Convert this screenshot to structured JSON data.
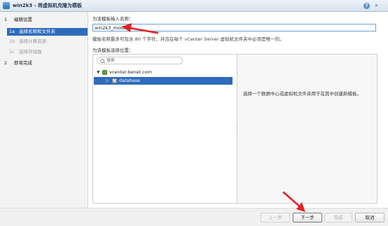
{
  "window": {
    "title": "win2k3 - 将虚拟机克隆为模板"
  },
  "sidebar": {
    "steps": [
      {
        "num": "1",
        "label": "编辑设置"
      },
      {
        "num": "1a",
        "label": "选择名称和文件夹"
      },
      {
        "num": "1b",
        "label": "选择计算资源"
      },
      {
        "num": "1c",
        "label": "选择存储器"
      },
      {
        "num": "2",
        "label": "即将完成"
      }
    ]
  },
  "main": {
    "name_label": "为该模板输入名称：",
    "name_value": "win2k3_mode",
    "name_hint": "模板名称最多可包含 80 个字符，并且在每个 vCenter Server 虚拟机文件夹中必须是唯一的。",
    "location_label": "为该模板选择位置：",
    "search_placeholder": "搜索",
    "tree": {
      "root": "vcenter.benet.com",
      "child": "database"
    },
    "right_info": "选择一个数据中心或虚拟机文件夹用于在其中创建新模板。"
  },
  "footer": {
    "back_label": "上一步",
    "next_label": "下一步",
    "finish_label": "完成",
    "cancel_label": "取消"
  },
  "colors": {
    "accent": "#2f6bbd",
    "annotation": "#e62020"
  }
}
